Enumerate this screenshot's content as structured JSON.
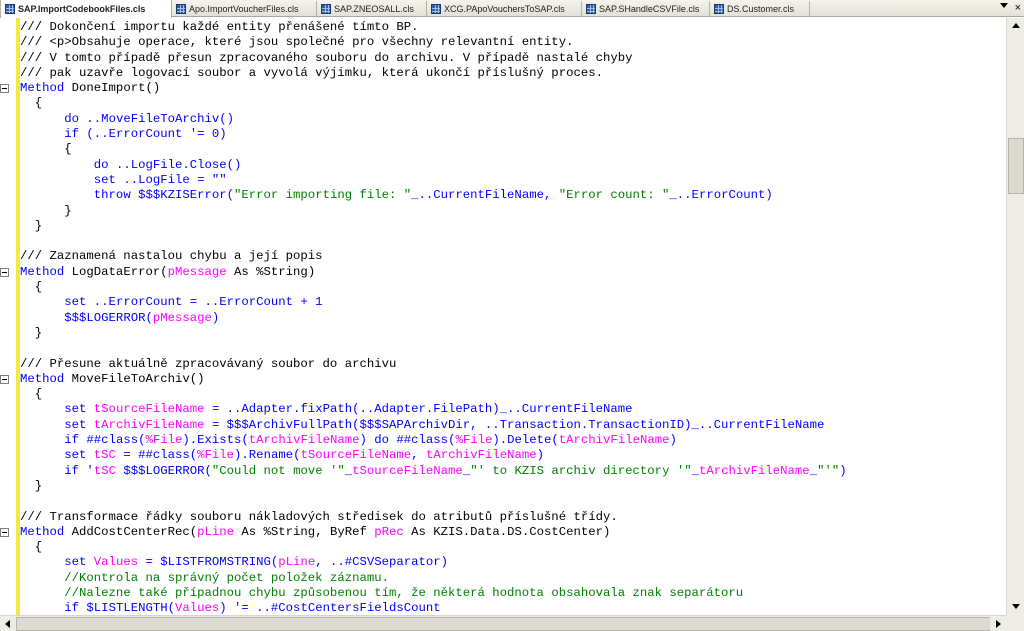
{
  "tabs": [
    {
      "label": "SAP.ImportCodebookFiles.cls",
      "active": true
    },
    {
      "label": "Apo.ImportVoucherFiles.cls",
      "active": false
    },
    {
      "label": "SAP.ZNEOSALL.cls",
      "active": false
    },
    {
      "label": "XCG.PApoVouchersToSAP.cls",
      "active": false
    },
    {
      "label": "SAP.SHandleCSVFile.cls",
      "active": false
    },
    {
      "label": "DS.Customer.cls",
      "active": false
    }
  ],
  "tab_close": "×",
  "code": {
    "l1": "/// Dokončení importu každé entity přenášené tímto BP.",
    "l2": "/// <p>Obsahuje operace, které jsou společné pro všechny relevantní entity.",
    "l3": "/// V tomto případě přesun zpracovaného souboru do archivu. V případě nastalé chyby",
    "l4": "/// pak uzavře logovací soubor a vyvolá výjimku, která ukončí příslušný proces.",
    "l5_kw": "Method",
    "l5_name": " DoneImport()",
    "open": "{",
    "close": "}",
    "l7_kw": "do",
    "l7_rest": " ..MoveFileToArchiv()",
    "l8_kw": "if",
    "l8_rest": " (..ErrorCount '= 0)",
    "l10_kw": "do",
    "l10_rest": " ..LogFile.Close()",
    "l11_kw": "set",
    "l11_rest": " ..LogFile = \"\"",
    "l12_kw": "throw",
    "l12_macro": " $$$KZISError(",
    "l12_s1": "\"Error importing file: \"",
    "l12_m1": "_..CurrentFileName, ",
    "l12_s2": "\"Error count: \"",
    "l12_m2": "_..ErrorCount)",
    "l16": "/// Zaznamená nastalou chybu a její popis",
    "l17_kw": "Method",
    "l17_name": " LogDataError(",
    "l17_param": "pMessage",
    "l17_as": " As %String)",
    "l19_kw": "set",
    "l19_rest": " ..ErrorCount = ..ErrorCount + 1",
    "l20_macro": "$$$LOGERROR(",
    "l20_param": "pMessage",
    "l20_end": ")",
    "l23": "/// Přesune aktuálně zpracovávaný soubor do archivu",
    "l24_kw": "Method",
    "l24_name": " MoveFileToArchiv()",
    "l26_kw": "set",
    "l26_var": " tSourceFileName",
    "l26_rest": " = ..Adapter.fixPath(..Adapter.FilePath)_..CurrentFileName",
    "l27_kw": "set",
    "l27_var": " tArchivFileName",
    "l27_rest": " = $$$ArchivFullPath($$$SAPArchivDir, ..Transaction.TransactionID)_..CurrentFileName",
    "l28_kw": "if",
    "l28_a": " ##class(",
    "l28_cls": "%File",
    "l28_b": ").Exists(",
    "l28_v1": "tArchivFileName",
    "l28_c": ") ",
    "l28_kw2": "do",
    "l28_d": " ##class(",
    "l28_cls2": "%File",
    "l28_e": ").Delete(",
    "l28_v2": "tArchivFileName",
    "l28_f": ")",
    "l29_kw": "set",
    "l29_var": " tSC",
    "l29_a": " = ##class(",
    "l29_cls": "%File",
    "l29_b": ").Rename(",
    "l29_v1": "tSourceFileName",
    "l29_c": ", ",
    "l29_v2": "tArchivFileName",
    "l29_d": ")",
    "l30_kw": "if",
    "l30_a": " '",
    "l30_var": "tSC",
    "l30_b": " $$$LOGERROR(",
    "l30_s1": "\"Could not move '\"",
    "l30_c": "_",
    "l30_v1": "tSourceFileName",
    "l30_d": "_",
    "l30_s2": "\"' to KZIS archiv directory '\"",
    "l30_e": "_",
    "l30_v2": "tArchivFileName",
    "l30_f": "_",
    "l30_s3": "\"'\"",
    "l30_g": ")",
    "l33": "/// Transformace řádky souboru nákladových středisek do atributů příslušné třídy.",
    "l34_kw": "Method",
    "l34_name": " AddCostCenterRec(",
    "l34_p1": "pLine",
    "l34_a": " As %String, ByRef ",
    "l34_p2": "pRec",
    "l34_b": " As KZIS.Data.DS.CostCenter)",
    "l36_kw": "set",
    "l36_var": " Values",
    "l36_a": " = $LISTFROMSTRING(",
    "l36_p": "pLine",
    "l36_b": ", ..#CSVSeparator)",
    "l37": "//Kontrola na správný počet položek záznamu.",
    "l38": "//Nalezne také případnou chybu způsobenou tím, že některá hodnota obsahovala znak separátoru",
    "l39_kw": "if",
    "l39_a": " $LISTLENGTH(",
    "l39_var": "Values",
    "l39_b": ") '= ..#CostCentersFieldsCount"
  }
}
